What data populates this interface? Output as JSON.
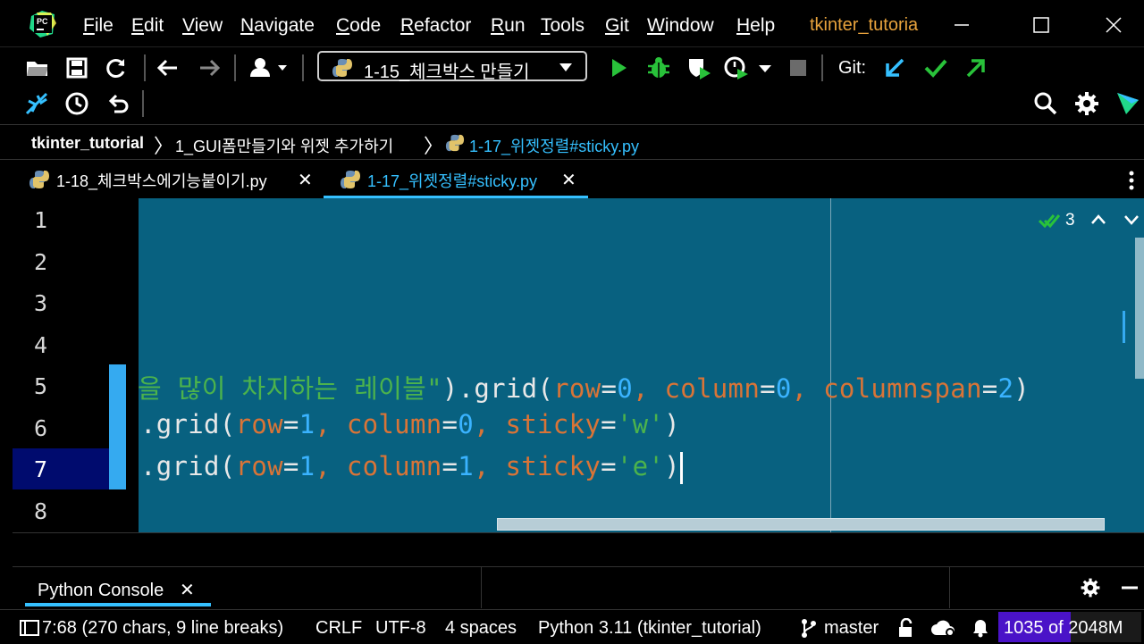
{
  "menu": {
    "items": [
      "File",
      "Edit",
      "View",
      "Navigate",
      "Code",
      "Refactor",
      "Run",
      "Tools",
      "Git",
      "Window",
      "Help"
    ],
    "project_title": "tkinter_tutoria"
  },
  "toolbar": {
    "run_config": "1-15_체크박스 만들기",
    "git_label": "Git:"
  },
  "breadcrumb": {
    "project": "tkinter_tutorial",
    "folder": "1_GUI폼만들기와 위젯 추가하기",
    "file": "1-17_위젯정렬#sticky.py"
  },
  "tabs": [
    {
      "label": "1-18_체크박스에기능붙이기.py",
      "active": false
    },
    {
      "label": "1-17_위젯정렬#sticky.py",
      "active": true
    }
  ],
  "editor": {
    "line_numbers": [
      "1",
      "2",
      "3",
      "4",
      "5",
      "6",
      "7",
      "8"
    ],
    "inspection_count": "3",
    "line5": {
      "str": "을 많이 차지하는 레이블\"",
      "mid": ").grid(",
      "p1": "row",
      "eq1": "=",
      "v1": "0",
      "c1": ", ",
      "p2": "column",
      "eq2": "=",
      "v2": "0",
      "c2": ", ",
      "p3": "columnspan",
      "eq3": "=",
      "v3": "2",
      "end": ")"
    },
    "line6": {
      "pre": ".grid(",
      "p1": "row",
      "eq1": "=",
      "v1": "1",
      "c1": ", ",
      "p2": "column",
      "eq2": "=",
      "v2": "0",
      "c2": ", ",
      "p3": "sticky",
      "eq3": "=",
      "v3": "'w'",
      "end": ")"
    },
    "line7": {
      "pre": ".grid(",
      "p1": "row",
      "eq1": "=",
      "v1": "1",
      "c1": ", ",
      "p2": "column",
      "eq2": "=",
      "v2": "1",
      "c2": ", ",
      "p3": "sticky",
      "eq3": "=",
      "v3": "'e'",
      "end": ")"
    }
  },
  "console": {
    "tab_label": "Python Console"
  },
  "status": {
    "position": "7:68 (270 chars, 9 line breaks)",
    "line_sep": "CRLF",
    "encoding": "UTF-8",
    "indent": "4 spaces",
    "interpreter": "Python 3.11 (tkinter_tutorial)",
    "branch": "master",
    "memory": "1035 of 2048M",
    "memory_fraction": 0.505
  },
  "colors": {
    "editor_bg": "#086180",
    "accent": "#35c0ff",
    "string": "#4cb34c",
    "param": "#d97437",
    "number": "#3ab3ff",
    "project_title": "#e8a33d"
  }
}
